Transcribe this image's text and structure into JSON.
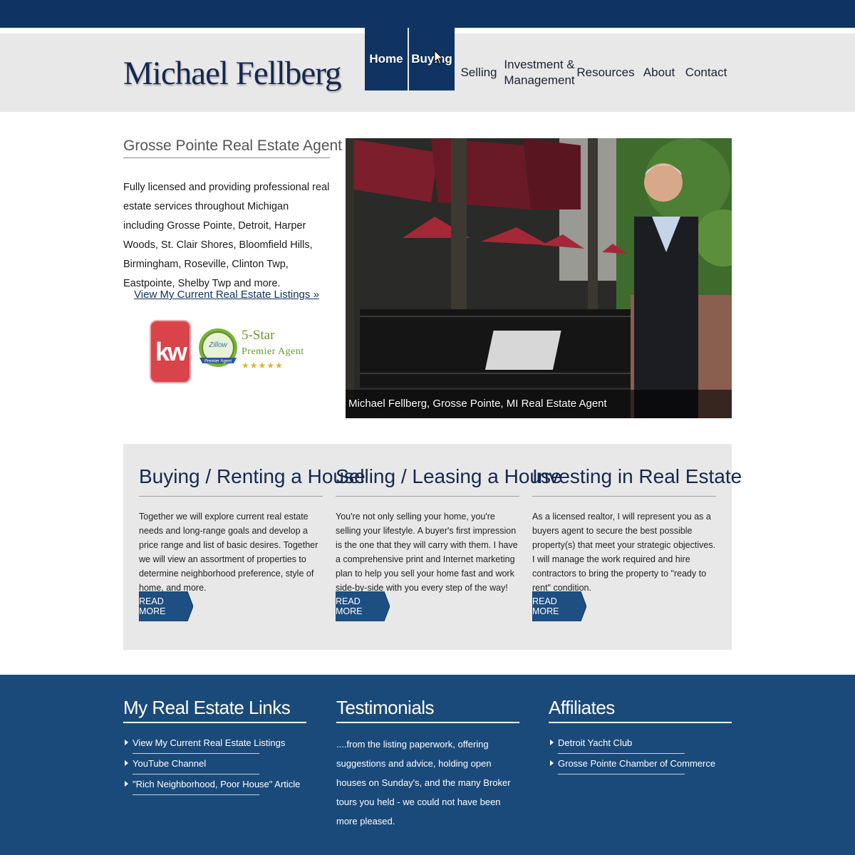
{
  "brand": {
    "name": "Michael Fellberg"
  },
  "nav": {
    "items": [
      {
        "label": "Home"
      },
      {
        "label": "Buying"
      },
      {
        "label": "Selling"
      },
      {
        "label": "Investment & Management"
      },
      {
        "label": "Resources"
      },
      {
        "label": "About"
      },
      {
        "label": "Contact"
      }
    ],
    "active_index": 0
  },
  "intro": {
    "title": "Grosse Pointe Real Estate Agent",
    "text": "Fully licensed and providing professional real estate services throughout Michigan including Grosse Pointe, Detroit, Harper Woods, St. Clair Shores, Bloomfield Hills, Birmingham, Roseville, Clinton Twp, Eastpointe, Shelby Twp and more.",
    "link": "View My Current Real Estate Listings »"
  },
  "badges": {
    "kw": "kw",
    "zillow": "Zillow",
    "zillow_ribbon": "Premier Agent",
    "star_title": "5-Star",
    "star_sub": "Premier Agent",
    "stars": "★★★★★"
  },
  "hero": {
    "caption": "Michael Fellberg, Grosse Pointe, MI Real Estate Agent"
  },
  "services": [
    {
      "title": "Buying / Renting a House",
      "text": "Together we will explore current real estate needs and long-range goals and develop a price range and list of basic desires. Together we will view an assortment of properties to determine neighborhood preference, style of home, and more.",
      "button": "READ MORE"
    },
    {
      "title": "Selling / Leasing a House",
      "text": "You're not only selling your home, you're selling your lifestyle. A buyer's first impression is the one that they will carry with them. I have a comprehensive print and Internet marketing plan to help you sell your home fast and work side-by-side with you every step of the way!",
      "button": "READ MORE"
    },
    {
      "title": "Investing in Real Estate",
      "text": "As a licensed realtor, I will represent you as a buyers agent to secure the best possible property(s) that meet your strategic objectives. I will manage the work required and hire contractors to bring the property to \"ready to rent\" condition.",
      "button": "READ MORE"
    }
  ],
  "footer": {
    "links_title": "My Real Estate Links",
    "links": [
      "View My Current Real Estate Listings",
      "YouTube Channel",
      "\"Rich Neighborhood, Poor House\" Article"
    ],
    "testimonials_title": "Testimonials",
    "testimonial": "....from the listing paperwork, offering suggestions and advice, holding open houses on Sunday's, and the many Broker tours you held - we could not have been more pleased.",
    "affiliates_title": "Affiliates",
    "affiliates": [
      "Detroit Yacht Club",
      "Grosse Pointe Chamber of Commerce"
    ]
  },
  "colors": {
    "navy": "#0f3463",
    "footer_blue": "#1a4a7a",
    "panel_gray": "#e8e8e8",
    "kw_red": "#d9434a",
    "zillow_green": "#6b9a2c"
  },
  "icons": [
    "mouse-cursor-icon",
    "list-arrow-icon",
    "keller-williams-logo",
    "zillow-badge-icon",
    "star-icon"
  ]
}
